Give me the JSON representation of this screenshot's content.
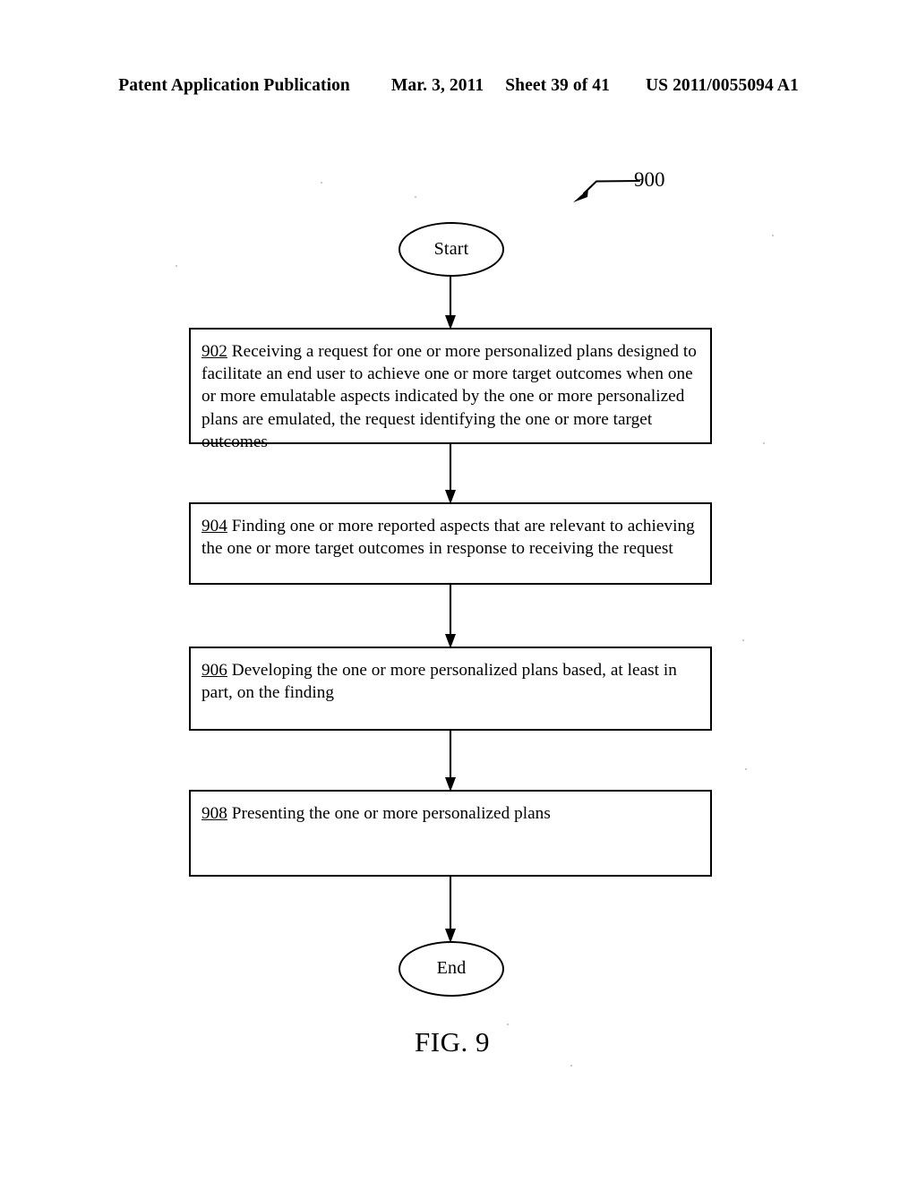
{
  "header": {
    "publication": "Patent Application Publication",
    "date": "Mar. 3, 2011",
    "sheet": "Sheet 39 of 41",
    "pub_number": "US 2011/0055094 A1"
  },
  "figure": {
    "caption": "FIG. 9",
    "reference_numeral": "900",
    "terminators": {
      "start": "Start",
      "end": "End"
    },
    "steps": [
      {
        "number": "902",
        "text": " Receiving a request for one or more personalized plans designed to facilitate an end user to achieve one or more target outcomes when one or more emulatable aspects indicated by the one or more personalized plans are emulated, the request identifying the one or more target outcomes"
      },
      {
        "number": "904",
        "text": " Finding one or more reported aspects that are relevant to achieving the one or more target outcomes in response to receiving the request"
      },
      {
        "number": "906",
        "text": " Developing the one or more personalized plans based, at least in part, on the finding"
      },
      {
        "number": "908",
        "text": " Presenting the one or more personalized plans"
      }
    ]
  },
  "colors": {
    "ink": "#000000",
    "paper": "#ffffff"
  }
}
